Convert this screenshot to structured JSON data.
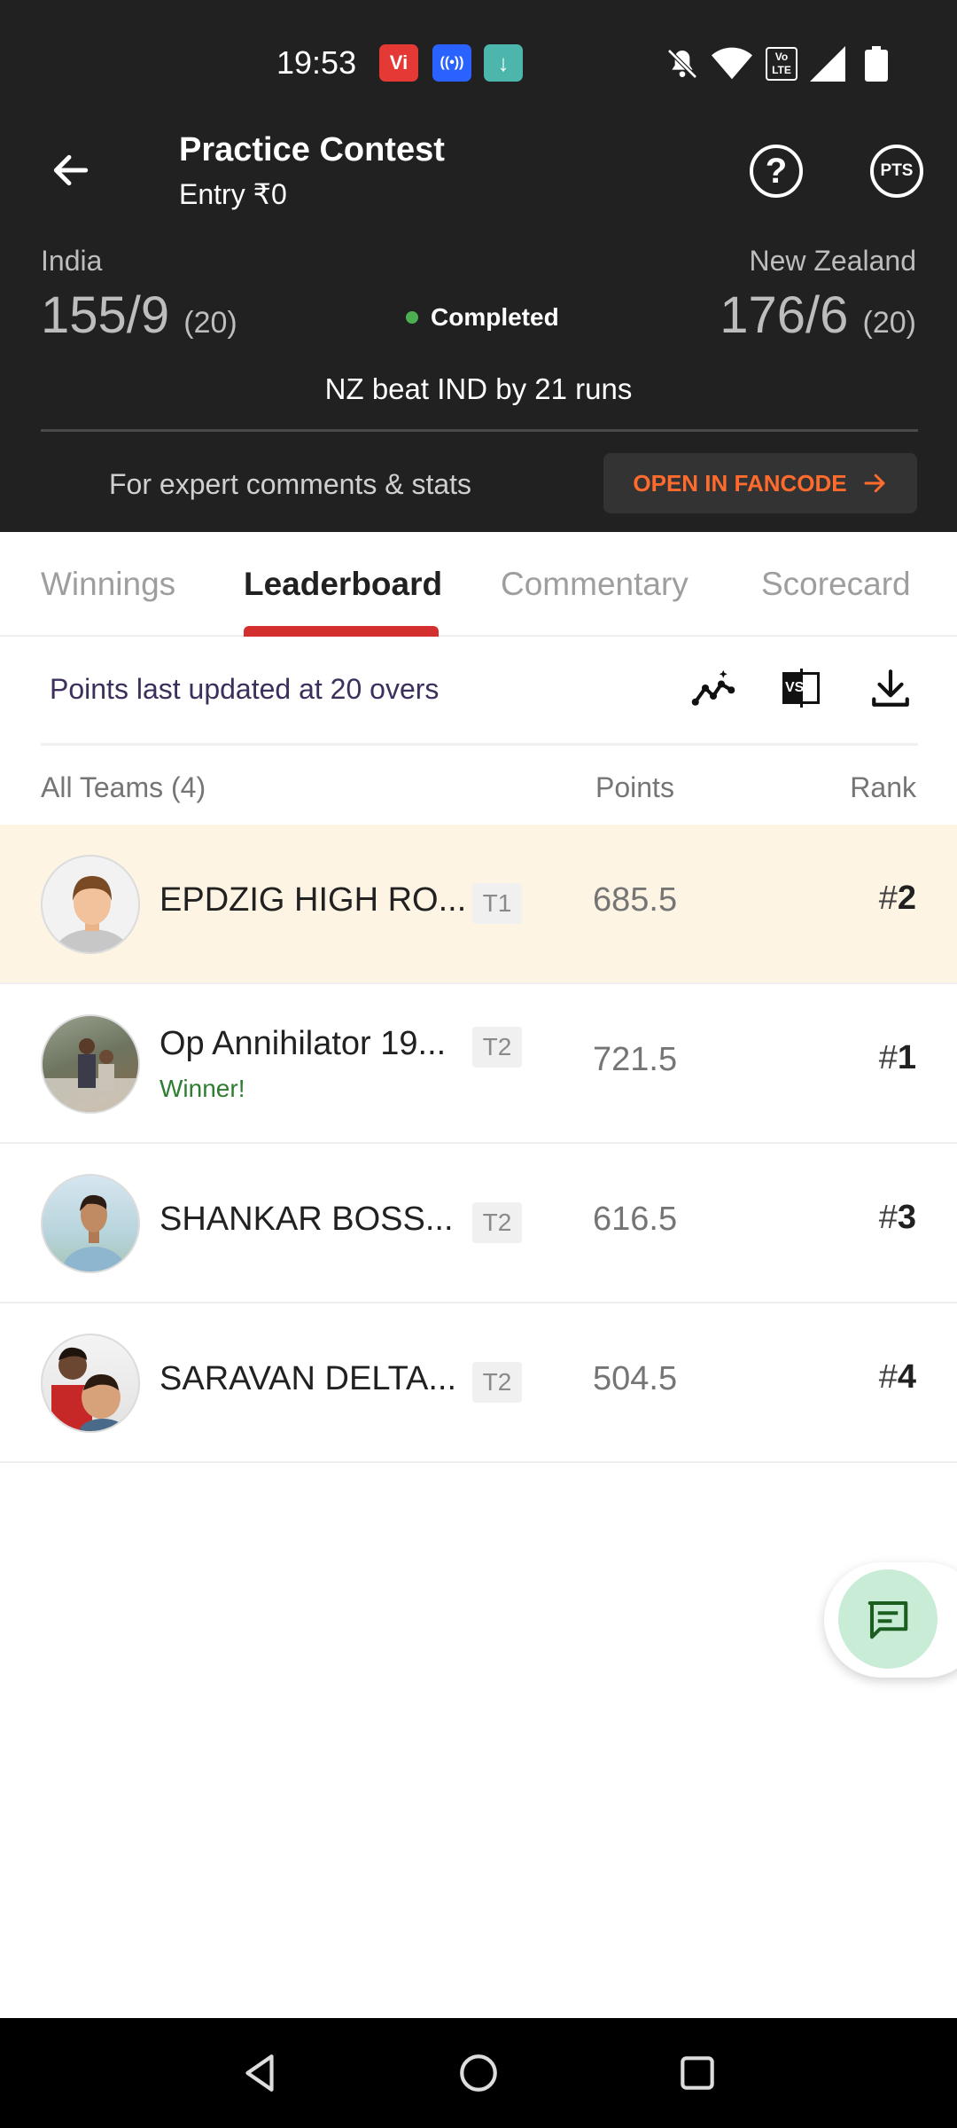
{
  "status_bar": {
    "time": "19:53",
    "app_icons": [
      {
        "name": "vi-app-icon",
        "label": "Vi",
        "color": "#e53935"
      },
      {
        "name": "broadcast-app-icon",
        "label": "((•))",
        "color": "#2962ff"
      },
      {
        "name": "download-app-icon",
        "label": "↓",
        "color": "#4db6ac"
      }
    ],
    "volte_label": "Vo\nLTE"
  },
  "header": {
    "title": "Practice Contest",
    "subtitle": "Entry ₹0",
    "help_icon": "?",
    "pts_label": "PTS"
  },
  "match": {
    "team1": {
      "name": "India",
      "score": "155/9",
      "overs": "(20)"
    },
    "team2": {
      "name": "New Zealand",
      "score": "176/6",
      "overs": "(20)"
    },
    "status": "Completed",
    "status_color": "#4caf50",
    "result": "NZ beat IND by 21 runs",
    "expert_text": "For expert comments & stats",
    "fancode_button": "OPEN IN FANCODE",
    "fancode_color": "#ff6b2c"
  },
  "tabs": [
    {
      "label": "Winnings",
      "active": false
    },
    {
      "label": "Leaderboard",
      "active": true
    },
    {
      "label": "Commentary",
      "active": false
    },
    {
      "label": "Scorecard",
      "active": false
    }
  ],
  "leaderboard": {
    "updated_text": "Points last updated at 20 overs",
    "tools": [
      "trend-chart-icon",
      "versus-icon",
      "download-icon"
    ],
    "vs_label": "VS",
    "headers": {
      "teams": "All Teams (4)",
      "points": "Points",
      "rank": "Rank"
    },
    "rows": [
      {
        "name": "EPDZIG HIGH RO...",
        "tag": "T1",
        "points": "685.5",
        "rank_hash": "#",
        "rank": "2",
        "sub": "",
        "highlight": true
      },
      {
        "name": "Op Annihilator 19...",
        "tag": "T2",
        "points": "721.5",
        "rank_hash": "#",
        "rank": "1",
        "sub": "Winner!",
        "highlight": false
      },
      {
        "name": "SHANKAR BOSS...",
        "tag": "T2",
        "points": "616.5",
        "rank_hash": "#",
        "rank": "3",
        "sub": "",
        "highlight": false
      },
      {
        "name": "SARAVAN DELTA...",
        "tag": "T2",
        "points": "504.5",
        "rank_hash": "#",
        "rank": "4",
        "sub": "",
        "highlight": false
      }
    ]
  },
  "accent_color": "#d32f2f"
}
